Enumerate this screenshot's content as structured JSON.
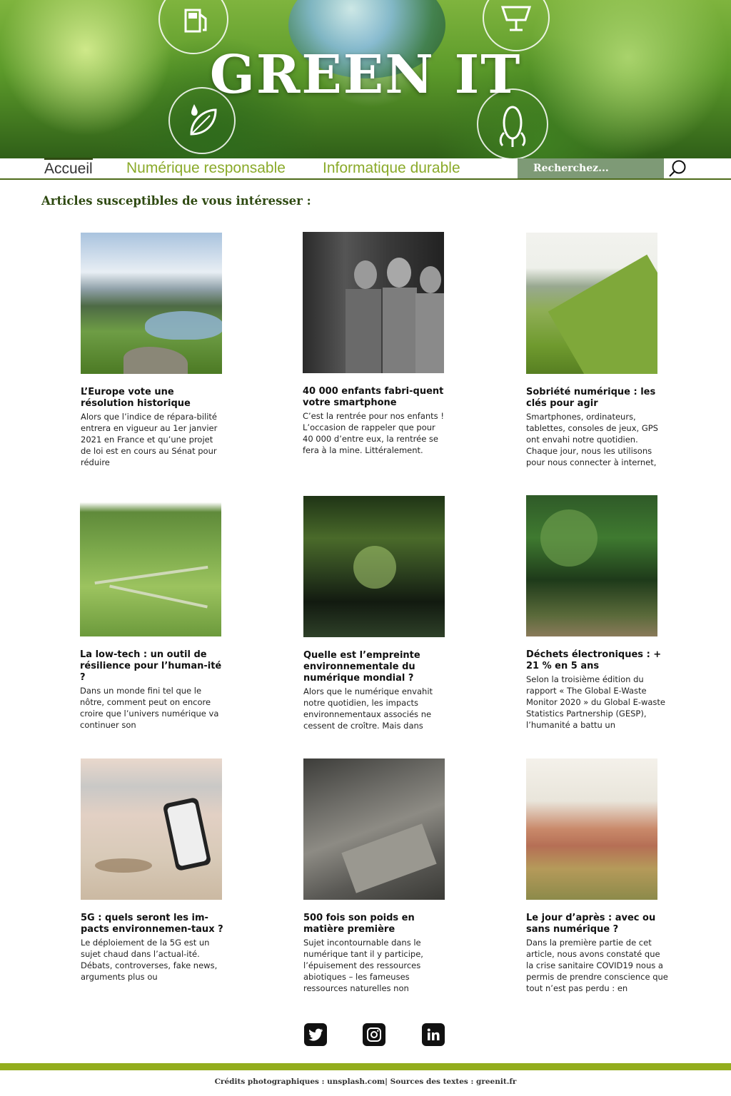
{
  "header": {
    "title": "GREEN IT",
    "icons": [
      "fuel-pump-icon",
      "globe-icon",
      "solar-panel-icon",
      "leaf-drop-icon",
      "corn-icon"
    ]
  },
  "nav": {
    "items": [
      {
        "label": "Accueil",
        "active": true
      },
      {
        "label": "Numérique responsable",
        "active": false
      },
      {
        "label": "Informatique durable",
        "active": false
      }
    ],
    "search_placeholder": "Recherchez..."
  },
  "section_title": "Articles susceptibles de vous intéresser :",
  "articles": [
    {
      "title": "L’Europe vote une résolution historique",
      "excerpt": "Alors que l’indice de répara-bilité entrera en vigueur au 1er janvier 2021 en France et qu’une projet de loi est en cours au Sénat pour réduire",
      "image": "lake-mountains-photo"
    },
    {
      "title": "40 000 enfants fabri-quent votre smartphone",
      "excerpt": "C’est la rentrée pour nos enfants ! L’occasion de rappeler que pour 40 000 d’entre eux, la rentrée se fera à la mine. Littéralement.",
      "image": "children-photo"
    },
    {
      "title": "Sobriété numérique : les clés pour agir",
      "excerpt": "Smartphones, ordinateurs, tablettes, consoles de jeux, GPS ont envahi notre quotidien. Chaque jour, nous les utilisons pour nous connecter à internet,",
      "image": "green-hills-photo"
    },
    {
      "title": "La low-tech : un outil de résilience pour l’human-ité ?",
      "excerpt": "Dans un monde fini tel que le nôtre, comment peut on encore croire que l’univers numérique va continuer son",
      "image": "valley-fields-photo"
    },
    {
      "title": "Quelle est l’empreinte environnementale du numérique mondial ?",
      "excerpt": "Alors que le numérique envahit notre quotidien, les impacts environnementaux associés ne cessent de croître. Mais dans",
      "image": "forest-river-photo"
    },
    {
      "title": "Déchets électroniques : + 21 % en 5 ans",
      "excerpt": "Selon la troisième édition du rapport « The Global E-Waste Monitor 2020 » du Global E-waste Statistics Partnership (GESP), l’humanité a battu un",
      "image": "palm-forest-photo"
    },
    {
      "title": "5G : quels seront les im-pacts environnemen-taux ?",
      "excerpt": "Le déploiement de la 5G est un sujet chaud dans l’actual-ité. Débats, controverses, fake news, arguments plus ou",
      "image": "beach-smartphone-photo"
    },
    {
      "title": "500 fois son poids en matière première",
      "excerpt": "Sujet incontournable dans le numérique tant il y participe, l’épuisement des ressources abiotiques – les fameuses ressources naturelles non",
      "image": "rock-slate-photo"
    },
    {
      "title": "Le jour d’après : avec ou sans numérique ?",
      "excerpt": "Dans la première partie de cet article, nous avons constaté que la crise sanitaire COVID19 nous a permis de prendre conscience que tout n’est pas perdu : en",
      "image": "desert-mine-photo"
    }
  ],
  "socials": [
    "twitter-icon",
    "instagram-icon",
    "linkedin-icon"
  ],
  "footer": {
    "credits": "Crédits photographiques : unsplash.com| Sources des textes : greenit.fr"
  },
  "colors": {
    "nav_active": "#2f4a12",
    "nav_link": "#8aaa2a",
    "search_bg": "#7e9a76",
    "footer_bar": "#93ad1d",
    "section_title": "#2f4a12"
  }
}
